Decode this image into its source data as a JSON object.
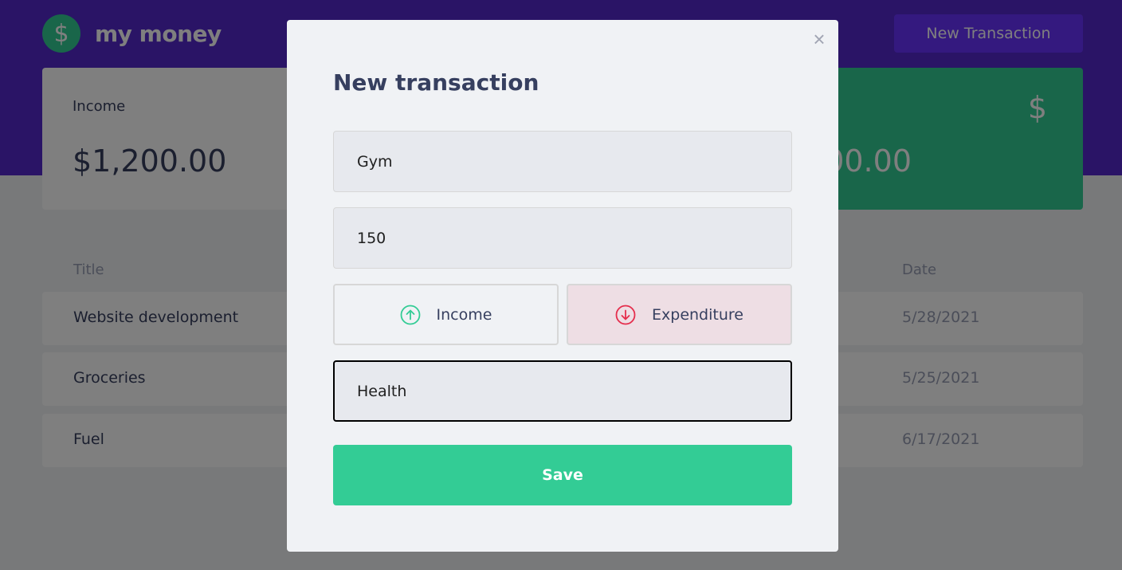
{
  "header": {
    "logo_symbol": "$",
    "app_name": "my money",
    "new_transaction_label": "New Transaction"
  },
  "summary": {
    "income": {
      "label": "Income",
      "value": "$1,200.00"
    },
    "total": {
      "value_visible": "00.00",
      "icon": "$"
    }
  },
  "table": {
    "headers": {
      "title": "Title",
      "date": "Date"
    },
    "rows": [
      {
        "title": "Website development",
        "date": "5/28/2021"
      },
      {
        "title": "Groceries",
        "date": "5/25/2021"
      },
      {
        "title": "Fuel",
        "date": "6/17/2021"
      }
    ]
  },
  "modal": {
    "close_symbol": "×",
    "title": "New transaction",
    "title_value": "Gym",
    "amount_value": "150",
    "income_label": "Income",
    "expenditure_label": "Expenditure",
    "category_value": "Health",
    "save_label": "Save",
    "selected_type": "expenditure"
  },
  "colors": {
    "header_bg": "#5429cc",
    "accent_green": "#33cc95",
    "expense_red": "#e52e4d",
    "button_purple": "#6933ff"
  },
  "icons": [
    "dollar-icon",
    "arrow-up-circle-icon",
    "arrow-down-circle-icon",
    "close-icon"
  ]
}
